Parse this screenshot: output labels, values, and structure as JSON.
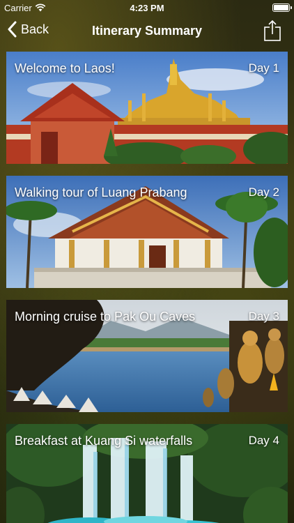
{
  "status_bar": {
    "carrier": "Carrier",
    "time": "4:23 PM",
    "battery_level": 1.0
  },
  "nav": {
    "back_label": "Back",
    "title": "Itinerary Summary",
    "share_icon": "share-icon"
  },
  "itinerary": [
    {
      "title": "Welcome to Laos!",
      "day": "Day 1",
      "scene": "golden-temple"
    },
    {
      "title": "Walking tour of Luang Prabang",
      "day": "Day 2",
      "scene": "white-temple-palms"
    },
    {
      "title": "Morning cruise to Pak Ou Caves",
      "day": "Day 3",
      "scene": "river-cave-buddhas"
    },
    {
      "title": "Breakfast at Kuang Si waterfalls",
      "day": "Day 4",
      "scene": "waterfall-forest"
    }
  ]
}
